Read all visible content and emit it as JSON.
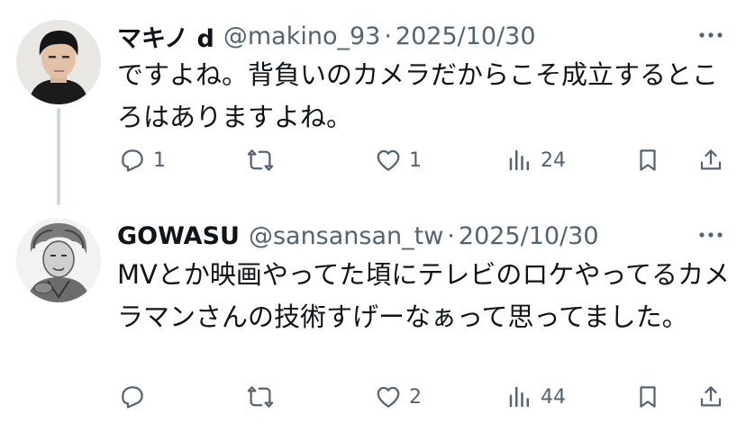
{
  "tweets": [
    {
      "name": "マキノ d",
      "handle": "@makino_93",
      "separator": "·",
      "date": "2025/10/30",
      "text": "ですよね。背負いのカメラだからこそ成立するところはありますよね。",
      "reply_count": "1",
      "repost_count": "",
      "like_count": "1",
      "view_count": "24"
    },
    {
      "name": "GOWASU",
      "handle": "@sansansan_tw",
      "separator": "·",
      "date": "2025/10/30",
      "text": "MVとか映画やってた頃にテレビのロケやってるカメラマンさんの技術すげーなぁって思ってました。",
      "reply_count": "",
      "repost_count": "",
      "like_count": "2",
      "view_count": "44"
    }
  ],
  "colors": {
    "text": "#0f1419",
    "secondary": "#536471",
    "thread_line": "#cfd9de"
  },
  "icons": [
    "more-icon",
    "reply-icon",
    "repost-icon",
    "like-icon",
    "views-icon",
    "bookmark-icon",
    "share-icon"
  ]
}
